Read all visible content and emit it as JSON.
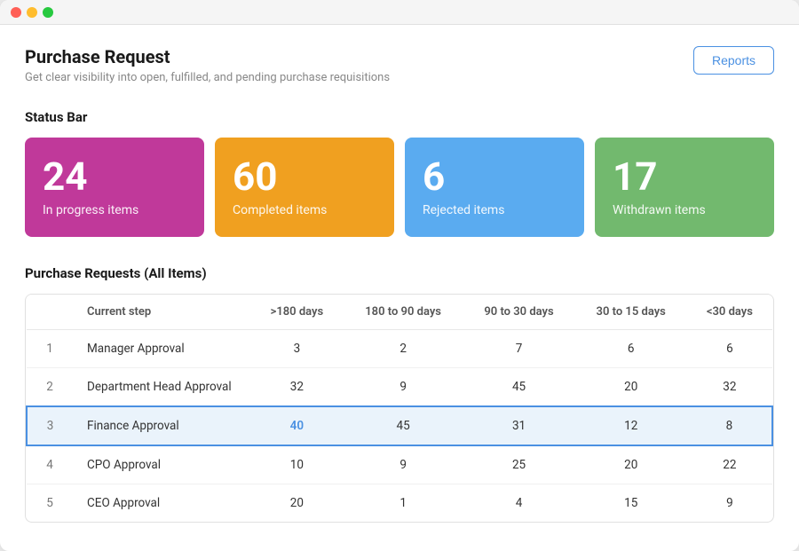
{
  "window": {
    "title": "Purchase Request"
  },
  "header": {
    "title": "Purchase Request",
    "subtitle": "Get clear visibility into open, fulfilled, and pending purchase requisitions",
    "reports_button": "Reports"
  },
  "status_bar": {
    "label": "Status Bar",
    "cards": [
      {
        "number": "24",
        "label": "In progress items",
        "class": "card-inprogress"
      },
      {
        "number": "60",
        "label": "Completed items",
        "class": "card-completed"
      },
      {
        "number": "6",
        "label": "Rejected items",
        "class": "card-rejected"
      },
      {
        "number": "17",
        "label": "Withdrawn items",
        "class": "card-withdrawn"
      }
    ]
  },
  "table": {
    "section_label": "Purchase Requests (All Items)",
    "columns": [
      "",
      "Current step",
      ">180 days",
      "180 to 90 days",
      "90 to 30 days",
      "30 to 15 days",
      "<30 days"
    ],
    "rows": [
      {
        "num": "1",
        "step": "Manager Approval",
        "c1": "3",
        "c2": "2",
        "c3": "7",
        "c4": "6",
        "c5": "6",
        "highlight": false,
        "highlight_col": null
      },
      {
        "num": "2",
        "step": "Department Head Approval",
        "c1": "32",
        "c2": "9",
        "c3": "45",
        "c4": "20",
        "c5": "32",
        "highlight": false,
        "highlight_col": null
      },
      {
        "num": "3",
        "step": "Finance Approval",
        "c1": "40",
        "c2": "45",
        "c3": "31",
        "c4": "12",
        "c5": "8",
        "highlight": true,
        "highlight_col": "c1"
      },
      {
        "num": "4",
        "step": "CPO Approval",
        "c1": "10",
        "c2": "9",
        "c3": "25",
        "c4": "20",
        "c5": "22",
        "highlight": false,
        "highlight_col": null
      },
      {
        "num": "5",
        "step": "CEO Approval",
        "c1": "20",
        "c2": "1",
        "c3": "4",
        "c4": "15",
        "c5": "9",
        "highlight": false,
        "highlight_col": null
      }
    ]
  }
}
